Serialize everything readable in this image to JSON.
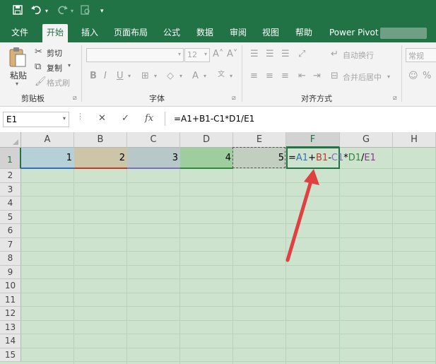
{
  "quick_access": {
    "icons": [
      "save-icon",
      "undo-icon",
      "redo-icon",
      "print-preview-icon",
      "customize-qat-icon"
    ]
  },
  "tabs": [
    {
      "label": "文件"
    },
    {
      "label": "开始"
    },
    {
      "label": "插入"
    },
    {
      "label": "页面布局"
    },
    {
      "label": "公式"
    },
    {
      "label": "数据"
    },
    {
      "label": "审阅"
    },
    {
      "label": "视图"
    },
    {
      "label": "帮助"
    },
    {
      "label": "Power Pivot"
    }
  ],
  "ribbon": {
    "clipboard": {
      "paste": "粘贴",
      "cut": "剪切",
      "copy": "复制",
      "format_painter": "格式刷",
      "label": "剪贴板"
    },
    "font": {
      "size": "12",
      "label": "字体"
    },
    "alignment": {
      "wrap": "自动换行",
      "merge": "合并后居中",
      "label": "对齐方式"
    },
    "number": {
      "format": "常规"
    }
  },
  "formula_bar": {
    "name_box": "E1",
    "fx": "fx",
    "formula": "=A1+B1-C1*D1/E1"
  },
  "grid": {
    "columns": [
      "A",
      "B",
      "C",
      "D",
      "E",
      "F",
      "G",
      "H"
    ],
    "rows": [
      "1",
      "2",
      "3",
      "4",
      "5",
      "6",
      "7",
      "8",
      "9",
      "10",
      "11",
      "12",
      "13",
      "14",
      "15"
    ],
    "cells": {
      "A1": "1",
      "B1": "2",
      "C1": "3",
      "D1": "4",
      "E1": "5"
    },
    "formula_parts": [
      {
        "text": "=",
        "color": "#000000"
      },
      {
        "text": "A1",
        "color": "#2f6fbf"
      },
      {
        "text": "+",
        "color": "#000000"
      },
      {
        "text": "B1",
        "color": "#c0392b"
      },
      {
        "text": "-",
        "color": "#000000"
      },
      {
        "text": "C1",
        "color": "#7b6fbf"
      },
      {
        "text": "*",
        "color": "#000000"
      },
      {
        "text": "D1",
        "color": "#2e8b3c"
      },
      {
        "text": "/",
        "color": "#000000"
      },
      {
        "text": "E1",
        "color": "#8b3a8b"
      }
    ]
  },
  "colors": {
    "excel_green": "#217346",
    "sheet_bg": "#cde3cd",
    "arrow": "#e04040"
  }
}
